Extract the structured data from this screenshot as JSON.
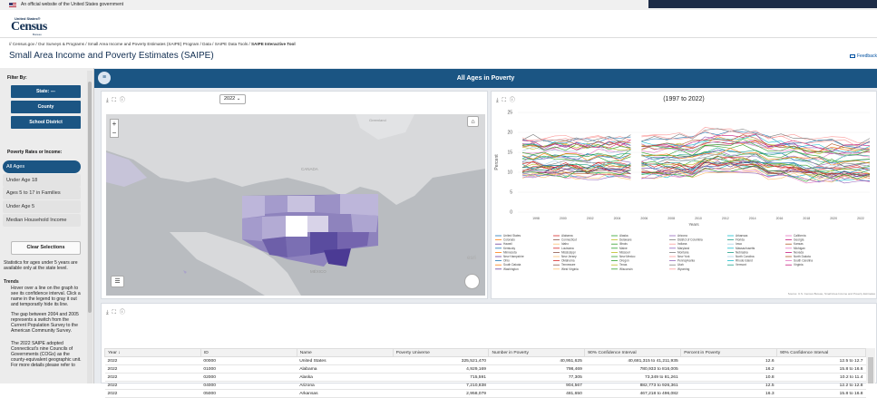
{
  "gov_banner": {
    "text": "An official website of the United States government"
  },
  "logo": {
    "small": "United States®",
    "big": "Census",
    "sub": "Bureau"
  },
  "breadcrumb": {
    "path": "// Census.gov  /  Our Surveys & Programs  /  Small Area Income and Poverty Estimates (SAIPE) Program  /  Data  /  SAIPE Data Tools  / ",
    "current": "SAIPE Interactive Tool"
  },
  "page_title": "Small Area Income and Poverty Estimates (SAIPE)",
  "feedback": "Feedback",
  "sidebar": {
    "filter_by": "Filter By:",
    "state_btn": "State: ---",
    "county_btn": "County",
    "school_btn": "School District",
    "rates_label": "Poverty Rates or Income:",
    "rates": [
      "All Ages",
      "Under Age 18",
      "Ages 5 to 17 in Families",
      "Under Age 5",
      "Median Household Income"
    ],
    "clear": "Clear Selections",
    "note1": "Statistics for ages under 5 years are available only at the state level.",
    "trends": "Trends",
    "trend1": "Hover over a line on the graph to see its confidence interval. Click a name in the legend to gray it out and temporarily hide its line.",
    "trend2": "The gap between 2004 and 2005 represents a switch from the Current Population Survey to the American Community Survey.",
    "trend3": "The 2022 SAIPE adopted Connecticut's nine Councils of Governments (COGs) as the county-equivalent geographic unit. For more details please refer to"
  },
  "main_title": "All Ages in Poverty",
  "map": {
    "year": "2022",
    "labels": {
      "canada": "CANADA",
      "mexico": "MÉXICO",
      "greenland": "Greenland",
      "esri": "esri"
    }
  },
  "chart": {
    "title": "(1997 to 2022)",
    "ylabel": "Percent",
    "xlabel": "Years",
    "source": "Source: U.S. Census Bureau, Small Area Income and Poverty Estimates",
    "yticks": [
      "0",
      "5",
      "10",
      "15",
      "20",
      "25"
    ],
    "xticks": [
      "1998",
      "2000",
      "2002",
      "2004",
      "2006",
      "2008",
      "2010",
      "2012",
      "2014",
      "2016",
      "2018",
      "2020",
      "2022"
    ],
    "legend": [
      "United States",
      "Alabama",
      "Alaska",
      "Arizona",
      "Arkansas",
      "California",
      "Colorado",
      "Connecticut",
      "Delaware",
      "District of Columbia",
      "Florida",
      "Georgia",
      "Hawaii",
      "Idaho",
      "Illinois",
      "Indiana",
      "Iowa",
      "Kansas",
      "Kentucky",
      "Louisiana",
      "Maine",
      "Maryland",
      "Massachusetts",
      "Michigan",
      "Minnesota",
      "Mississippi",
      "Missouri",
      "Montana",
      "Nebraska",
      "Nevada",
      "New Hampshire",
      "New Jersey",
      "New Mexico",
      "New York",
      "North Carolina",
      "North Dakota",
      "Ohio",
      "Oklahoma",
      "Oregon",
      "Pennsylvania",
      "Rhode Island",
      "South Carolina",
      "South Dakota",
      "Tennessee",
      "Texas",
      "Utah",
      "Vermont",
      "Virginia",
      "Washington",
      "West Virginia",
      "Wisconsin",
      "Wyoming"
    ],
    "colors": [
      "#1f77b4",
      "#d62728",
      "#2ca02c",
      "#9467bd",
      "#17becf",
      "#e377c2",
      "#ff7f0e",
      "#8c564b",
      "#bcbd22",
      "#7f7f7f",
      "#1f9e89",
      "#c51b7d",
      "#6a3d9a",
      "#fdbf6f",
      "#33a02c",
      "#fb9a99",
      "#a6cee3",
      "#b15928"
    ]
  },
  "table": {
    "headers": [
      "Year ↓",
      "ID",
      "Name",
      "Poverty Universe",
      "Number in Poverty",
      "90% Confidence Interval",
      "Percent in Poverty",
      "90% Confidence Interval"
    ],
    "rows": [
      [
        "2022",
        "00000",
        "United States",
        "325,521,470",
        "40,951,625",
        "40,681,315 to 41,211,935",
        "12.6",
        "12.5 to 12.7"
      ],
      [
        "2022",
        "01000",
        "Alabama",
        "4,929,169",
        "798,469",
        "780,933 to 816,005",
        "16.2",
        "15.8 to 16.6"
      ],
      [
        "2022",
        "02000",
        "Alaska",
        "715,591",
        "77,305",
        "73,349 to 81,261",
        "10.8",
        "10.2 to 11.4"
      ],
      [
        "2022",
        "04000",
        "Arizona",
        "7,210,838",
        "904,567",
        "882,773 to 926,361",
        "12.5",
        "12.2 to 12.8"
      ],
      [
        "2022",
        "05000",
        "Arkansas",
        "2,958,079",
        "481,650",
        "467,218 to 496,082",
        "16.3",
        "15.8 to 16.8"
      ]
    ]
  }
}
